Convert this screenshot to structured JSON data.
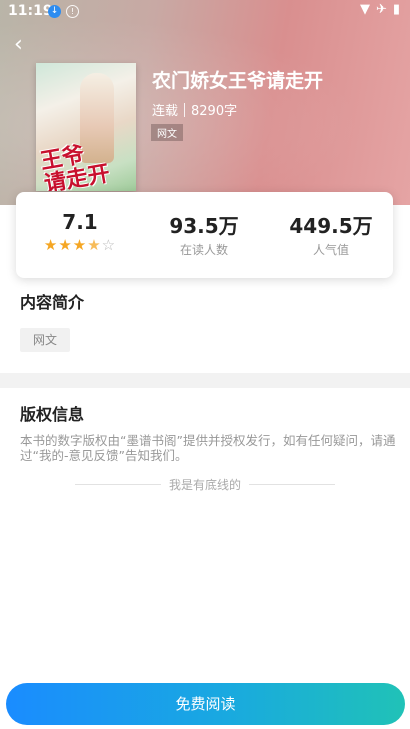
{
  "status_bar": {
    "time": "11:19",
    "icons": [
      "download-icon",
      "info-icon",
      "wifi-icon",
      "airplane-icon",
      "battery-icon"
    ]
  },
  "book": {
    "title": "农门娇女王爷请走开",
    "status": "连载",
    "word_count": "8290字",
    "tag": "网文",
    "cover_title": "王爷请走开"
  },
  "stats": {
    "rating": "7.1",
    "rating_stars": 3.5,
    "readers_value": "93.5万",
    "readers_label": "在读人数",
    "popularity_value": "449.5万",
    "popularity_label": "人气值"
  },
  "intro": {
    "title": "内容简介",
    "tag": "网文"
  },
  "copyright": {
    "title": "版权信息",
    "text": "本书的数字版权由“墨谱书阁”提供并授权发行，如有任何疑问，请通过“我的-意见反馈”告知我们。",
    "bottom_line": "我是有底线的"
  },
  "action": {
    "read_label": "免费阅读"
  },
  "colors": {
    "accent_start": "#1a8cff",
    "accent_end": "#20c2b7",
    "star": "#f5a623"
  }
}
